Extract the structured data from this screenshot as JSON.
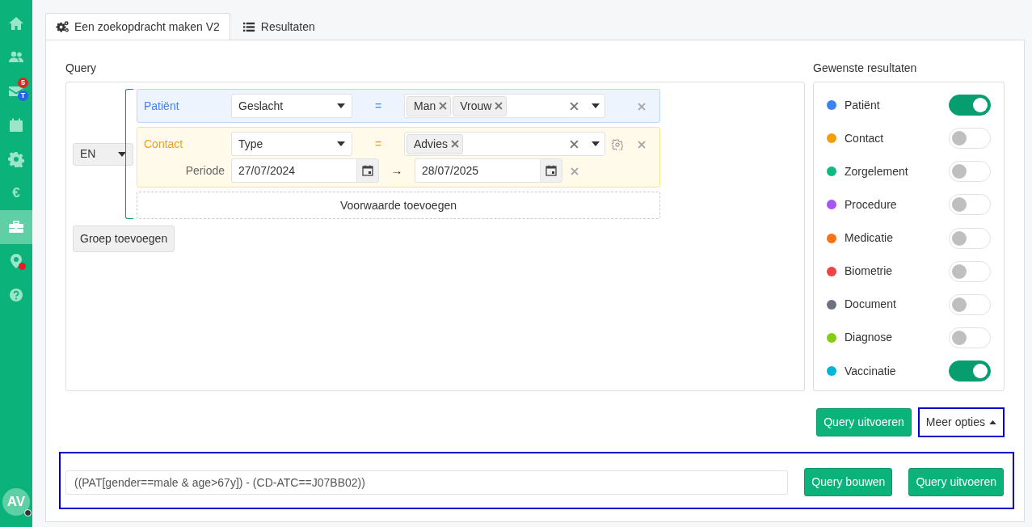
{
  "sidebar": {
    "items": [
      {
        "kind": "home",
        "selected": false
      },
      {
        "kind": "users",
        "selected": false
      },
      {
        "kind": "mail",
        "selected": false,
        "badges": [
          {
            "text": "5",
            "color": "#dc2626"
          },
          {
            "text": "T",
            "color": "#2563eb"
          }
        ]
      },
      {
        "kind": "calendar",
        "selected": false
      },
      {
        "kind": "gear",
        "selected": false
      },
      {
        "kind": "glyph",
        "glyph": "€",
        "selected": false
      },
      {
        "kind": "briefcase",
        "selected": true
      },
      {
        "kind": "pin",
        "selected": false,
        "alert": true
      },
      {
        "kind": "help",
        "selected": false
      }
    ],
    "avatar": {
      "initials": "AV"
    }
  },
  "tabs": [
    {
      "label": "Een zoekopdracht maken V2",
      "kind": "gears",
      "selected": true
    },
    {
      "label": "Resultaten",
      "kind": "list",
      "selected": false
    }
  ],
  "query": {
    "label": "Query",
    "operator": "EN",
    "conditions": [
      {
        "kind": "patient",
        "entity": "Patiënt",
        "field": "Geslacht",
        "op": "=",
        "values": [
          "Man",
          "Vrouw"
        ]
      },
      {
        "kind": "contact",
        "entity": "Contact",
        "field": "Type",
        "op": "=",
        "values": [
          "Advies"
        ],
        "period": {
          "label": "Periode",
          "from": "27/07/2024",
          "arrow": "→",
          "to": "28/07/2025"
        }
      }
    ],
    "add_condition": "Voorwaarde toevoegen",
    "add_group": "Groep toevoegen"
  },
  "results": {
    "title": "Gewenste resultaten",
    "items": [
      {
        "name": "Patiënt",
        "color": "#3b82f6",
        "on": true
      },
      {
        "name": "Contact",
        "color": "#f59e0b",
        "on": false
      },
      {
        "name": "Zorgelement",
        "color": "#10b981",
        "on": false
      },
      {
        "name": "Procedure",
        "color": "#a855f7",
        "on": false
      },
      {
        "name": "Medicatie",
        "color": "#f97316",
        "on": false
      },
      {
        "name": "Biometrie",
        "color": "#ef4444",
        "on": false
      },
      {
        "name": "Document",
        "color": "#6b7280",
        "on": false
      },
      {
        "name": "Diagnose",
        "color": "#84cc16",
        "on": false
      },
      {
        "name": "Vaccinatie",
        "color": "#06b6d4",
        "on": true
      }
    ]
  },
  "actions": {
    "run": "Query uitvoeren",
    "more": "Meer opties"
  },
  "builder": {
    "value": "((PAT[gender==male & age>67y]) - (CD-ATC==J07BB02))",
    "build": "Query bouwen",
    "run": "Query uitvoeren"
  }
}
